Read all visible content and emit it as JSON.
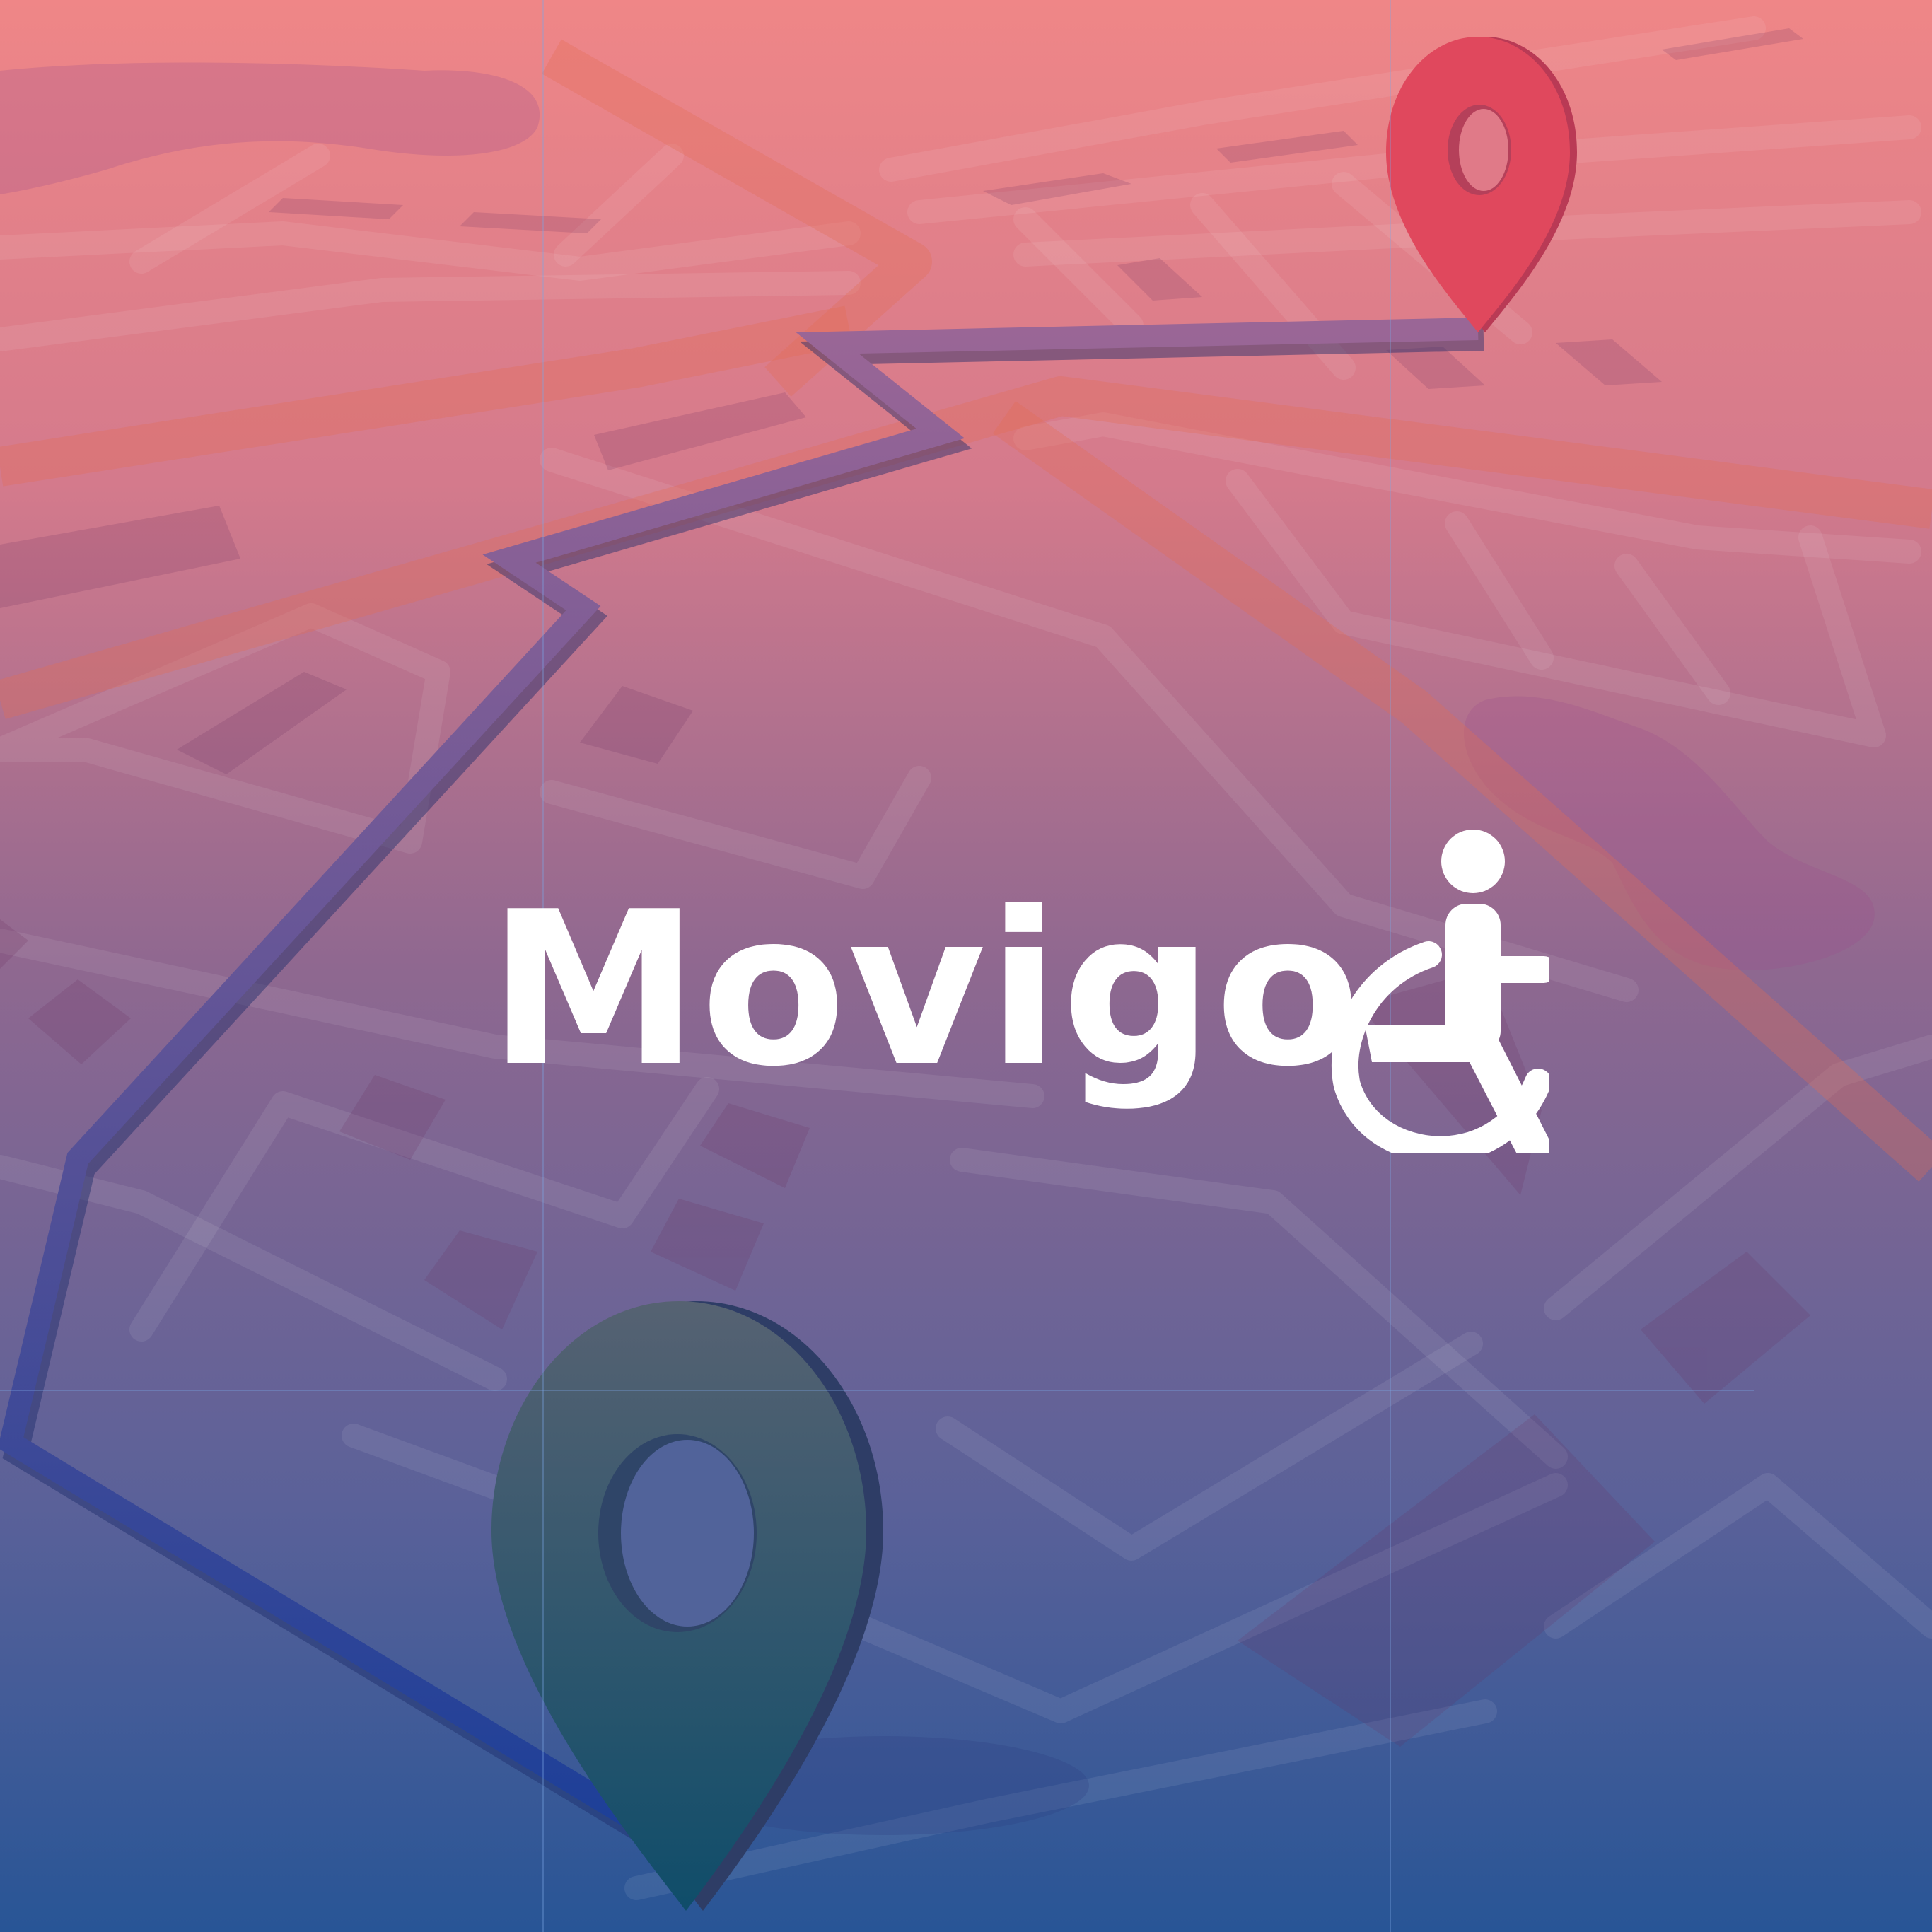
{
  "app": {
    "name": "Movigo"
  },
  "logo": {
    "wordmark": "Movigo",
    "icon": "wheelchair-accessibility-icon",
    "text_color": "#ffffff"
  },
  "map": {
    "route_color": "#4a5aa8",
    "start_pin_icon": "map-pin-icon",
    "start_pin_color": "#1f4f6c",
    "destination_pin_icon": "map-pin-icon",
    "destination_pin_color": "#e0485d"
  },
  "colors": {
    "background_top": "#ee8586",
    "background_middle": "#8d6a92",
    "background_bottom": "#285596"
  }
}
